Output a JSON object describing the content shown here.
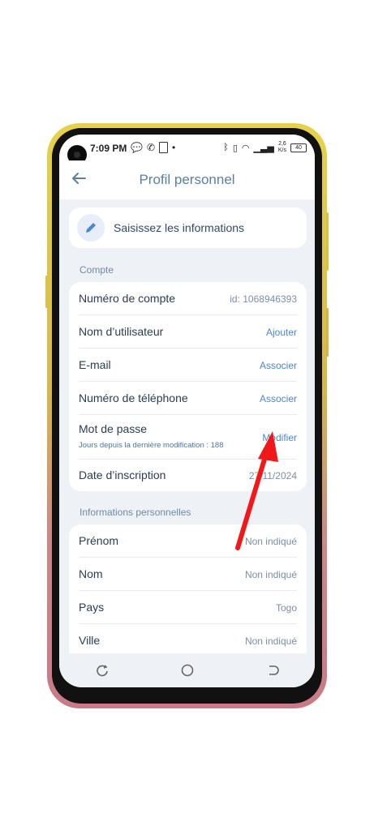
{
  "status_bar": {
    "time": "7:09 PM",
    "network_speed": "2,6",
    "speed_unit": "K/s",
    "battery": "40"
  },
  "app_bar": {
    "title": "Profil personnel",
    "back_icon": "arrow-left-icon"
  },
  "info_card": {
    "icon": "pencil-icon",
    "label": "Saisissez les informations"
  },
  "account_section": {
    "title": "Compte",
    "rows": [
      {
        "label": "Numéro de compte",
        "value": "id: 1068946393"
      },
      {
        "label": "Nom d’utilisateur",
        "value": "Ajouter"
      },
      {
        "label": "E-mail",
        "value": "Associer"
      },
      {
        "label": "Numéro de téléphone",
        "value": "Associer"
      },
      {
        "label": "Mot de passe",
        "value": "Modifier",
        "sub": "Jours depuis la dernière modification :  188"
      },
      {
        "label": "Date d’inscription",
        "value": "27/11/2024"
      }
    ]
  },
  "personal_section": {
    "title": "Informations personnelles",
    "rows": [
      {
        "label": "Prénom",
        "value": "Non indiqué"
      },
      {
        "label": "Nom",
        "value": "Non indiqué"
      },
      {
        "label": "Pays",
        "value": "Togo"
      },
      {
        "label": "Ville",
        "value": "Non indiqué"
      }
    ]
  },
  "annotation": {
    "arrow_color": "#f01818"
  },
  "colors": {
    "accent": "#4a85d6",
    "title": "#5a7fa3",
    "background": "#eef1f5"
  }
}
